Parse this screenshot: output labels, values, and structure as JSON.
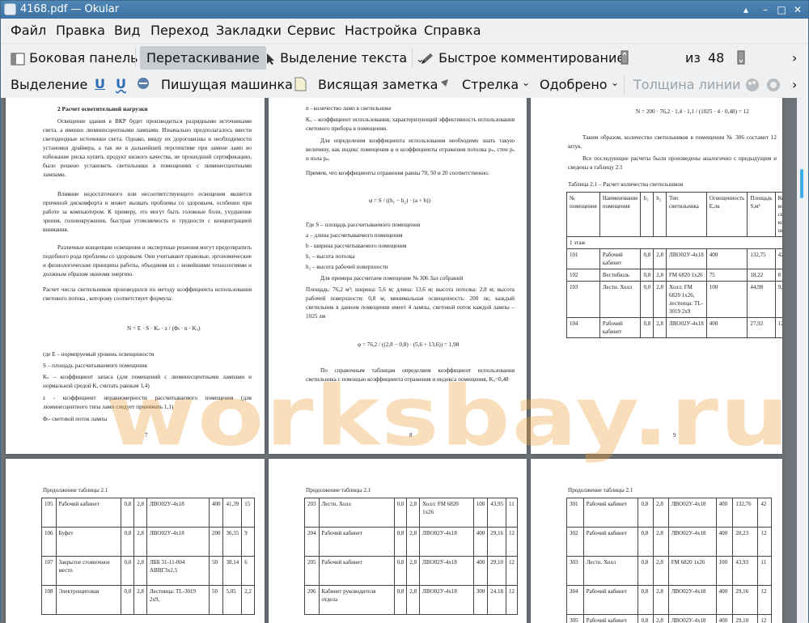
{
  "window": {
    "title": "4168.pdf — Okular"
  },
  "menu": [
    "Файл",
    "Правка",
    "Вид",
    "Переход",
    "Закладки",
    "Сервис",
    "Настройка",
    "Справка"
  ],
  "toolbar1": {
    "sidebar": "Боковая панель",
    "drag": "Перетаскивание",
    "text_select": "Выделение текста",
    "quick_annot": "Быстрое комментирование",
    "page_current": "8",
    "of": "из",
    "page_total": "48"
  },
  "toolbar2": {
    "select": "Выделение",
    "typewriter": "Пишущая машинка",
    "note": "Висящая заметка",
    "arrow": "Стрелка",
    "approved": "Одобрено",
    "line_width": "Толщина линии"
  },
  "watermark": "worksbay.ru",
  "page7": {
    "heading": "2 Расчет осветительной нагрузки",
    "paras": [
      "Освещение здания в ВКР будет производиться разрядными источниками света, а именно люминесцентными лампами. Изначально предполагалось ввести светодиодные источники света. Однако, ввиду их дороговизны и необходимости установки драйвера, а так же в дальнейшей перспективе при замене ламп во избежание риска купить продукт низкого качества, не прошедший сертификацию, было решено установить светильники в помещениях с люминесцентными лампами.",
      "Влияние недостаточного или несоответствующего освещения является причиной дискомфорта и может вызвать проблемы со здоровьем, особенно при работе за компьютером. К примеру, это могут быть головные боли, ухудшение зрения, головокружения, быстрая утомляемость и трудности с концентрацией внимания.",
      "Различные концепции освещения и экспертные решения могут предотвратить подобного рода проблемы со здоровьем. Они учитывают правовые, эргономические и физиологические принципы работы, объединяя их с новейшими технологиями и должным образом экономя энергию.",
      "Расчет числа светильников производился по методу коэффициента использования светового потока , которому соответствует формула:"
    ],
    "formula": "N = E · S · Kₛ · z / (Φₗ · n · Kᵤ)",
    "defs": [
      "где E – нормируемый уровень освещенности",
      "S – площадь рассчитываемого помещения",
      "Kₛ – коэффициент запаса (для помещений с люминесцентными лампами и нормальной средой K, считать равным 1,4)",
      "z - коэффициент неравномерности рассчитываемого помещения (для люминесцентного типа ламп следует принимать 1,1)",
      "Φₗ- световой поток лампы"
    ],
    "num": "7"
  },
  "page8": {
    "lines": [
      "n - количество ламп в светильнике",
      "Kᵤ – коэффициент использования, характеризующий эффективность использования светового прибора в помещении.",
      "Для определения коэффициента использования необходимо знать такую величину, как индекс помещения φ и коэффициенты отражения потолка pₙ, стен pₛ и пола pₚ.",
      "Примем, что коэффициенты отражения равны 70, 50 и 20 соответственно."
    ],
    "formula1": "φ = S / ((h₁ − h₂) · (a + b))",
    "defs": [
      "Где S – площадь рассчитываемого помещения",
      "a – длина рассчитываемого помещения",
      "b - ширина рассчитываемого помещения",
      "h₁ – высота потолка",
      "h₂ – высота рабочей поверхности"
    ],
    "example": "Для примера рассчитаем помещение № 306 Зал собраний",
    "example2": "Площадь: 76,2 м²; ширина: 5,6 м; длина: 13,6 м; высота потолка: 2,8 м; высота рабочей поверхности: 0,8 м; минимальная освещенность: 200 лк; каждый светильник в данном помещении имеет 4 лампы, световой поток каждой лампы –1025 лм",
    "formula2": "φ = 76,2 / ((2,8 − 0,8) · (5,6 + 13,6)) = 1,98",
    "after": "По справочным таблицам определяем коэффициент использования светильника с помощью коэффициента отражения и индекса помещения, Kᵤ=0,48",
    "num": "8"
  },
  "page9": {
    "formula": "N = 200 · 76,2 · 1,4 · 1,1 / (1025 · 4 · 0,48) = 12",
    "para1": "Таким образом, количество светильников в помещении № 306 составит 12 штук.",
    "para2": "Все последующие расчеты были произведены аналогично с предыдущим и сведены в таблицу 2.1",
    "caption": "Таблица 2.1 – Расчет количества светильников",
    "header": [
      "№ помещения",
      "Наименование помещения",
      "h₁",
      "h₂",
      "Тип светильника",
      "Освещенность E,лк",
      "Площадь S,м²",
      "Кол-во свет-ков, шт."
    ],
    "floor": "1 этаж",
    "rows": [
      [
        "101",
        "Рабочий кабинет",
        "0,8",
        "2,8",
        "ЛВО02У-4х18",
        "400",
        "132,75",
        "42"
      ],
      [
        "102",
        "Вестибюль",
        "0,8",
        "2,8",
        "FM 6820 1х26",
        "75",
        "18,22",
        "8"
      ],
      [
        "103",
        "Лестн. Холл",
        "0,0",
        "2,8",
        "Холл: FM 6820 1х26, лестница: TL-3019 2х9",
        "100",
        "44,98",
        "9,4"
      ],
      [
        "104",
        "Рабочий кабинет",
        "0,8",
        "2,8",
        "ЛВО02У-4х18",
        "400",
        "27,92",
        "12"
      ]
    ],
    "num": "9"
  },
  "page10": {
    "caption": "Продолжение таблицы 2.1",
    "rows": [
      [
        "105",
        "Рабочий кабинет",
        "0,8",
        "2,8",
        "ЛВО02У-4х18",
        "400",
        "41,39",
        "15"
      ],
      [
        "106",
        "Буфет",
        "0,8",
        "2,8",
        "ЛВО02У-4х18",
        "200",
        "36,35",
        "9"
      ],
      [
        "107",
        "Закрытое стояночное место",
        "0,0",
        "2,8",
        "ЛББ 31-11-004 АВВГ3х2,5",
        "50",
        "38,14",
        "6"
      ],
      [
        "108",
        "Электрощитовая",
        "0,0",
        "2,8",
        "Лестница: TL-3019 2х9,",
        "50",
        "5,05",
        "2,2"
      ]
    ]
  },
  "page11": {
    "caption": "Продолжение таблицы 2.1",
    "rows": [
      [
        "203",
        "Лестн. Холл",
        "0,0",
        "2,8",
        "Холл: FM 6820 1х26",
        "100",
        "43,95",
        "11"
      ],
      [
        "204",
        "Рабочий кабинет",
        "0,8",
        "2,8",
        "ЛВО02У-4х18",
        "400",
        "29,16",
        "12"
      ],
      [
        "205",
        "Рабочий кабинет",
        "0,8",
        "2,8",
        "ЛВО02У-4х18",
        "400",
        "29,10",
        "12"
      ],
      [
        "206",
        "Кабинет руководителя отдела",
        "0,8",
        "2,8",
        "ЛВО02У-4х18",
        "300",
        "24,18",
        "12"
      ]
    ]
  },
  "page12": {
    "caption": "Продолжение таблицы 2.1",
    "rows": [
      [
        "301",
        "Рабочий кабинет",
        "0,8",
        "2,8",
        "ЛВО02У-4х18",
        "400",
        "132,76",
        "42"
      ],
      [
        "302",
        "Рабочий кабинет",
        "0,8",
        "2,8",
        "ЛВО02У-4х18",
        "400",
        "20,23",
        "12"
      ],
      [
        "303",
        "Лестн. Холл",
        "0,8",
        "2,8",
        "FM 6820 1х26",
        "100",
        "43,93",
        "11"
      ],
      [
        "304",
        "Рабочий кабинет",
        "0,8",
        "2,8",
        "ЛВО02У-4х18",
        "400",
        "29,16",
        "12"
      ],
      [
        "305",
        "Рабочий кабинет",
        "0,8",
        "2,8",
        "ЛВО02У-4х18",
        "400",
        "29,10",
        "12"
      ]
    ]
  }
}
